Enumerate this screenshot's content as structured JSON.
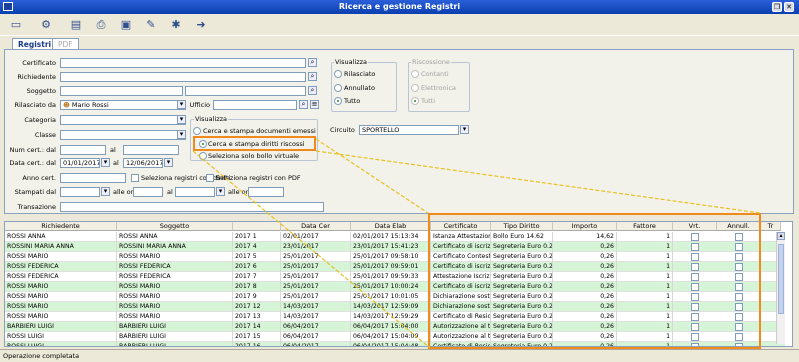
{
  "window": {
    "title": "Ricerca e gestione Registri"
  },
  "toolbar": {
    "icons": [
      "new-icon",
      "tools-icon",
      "document-icon",
      "print-icon",
      "save-icon",
      "edit-icon",
      "settings-icon",
      "exit-icon"
    ]
  },
  "tabs": [
    {
      "label": "Registri"
    },
    {
      "label": "PDF"
    }
  ],
  "form": {
    "certificato_label": "Certificato",
    "richiedente_label": "Richiedente",
    "soggetto_label": "Soggetto",
    "rilasciato_label": "Rilasciato da",
    "rilasciato_value": "Mario Rossi",
    "ufficio_label": "Ufficio",
    "categoria_label": "Categoria",
    "classe_label": "Classe",
    "numcert_label": "Num cert.: dal",
    "al_label": "al",
    "datacert_label": "Data cert.: dal",
    "data_dal": "01/01/2017",
    "data_al": "12/06/2017",
    "anno_label": "Anno cert.",
    "chk_diritti": "Seleziona registri con diritti",
    "chk_pdf": "Seleziona registri con PDF",
    "stampati_label": "Stampati dal",
    "alle_ore": "alle ore",
    "al2": "al",
    "alle_ore2": "alle ore",
    "transazione_label": "Transazione",
    "circuito_label": "Circuito",
    "circuito_value": "SPORTELLO"
  },
  "visualizza1": {
    "title": "Visualizza",
    "options": [
      "Cerca e stampa documenti emessi",
      "Cerca e stampa diritti riscossi",
      "Seleziona solo bollo virtuale"
    ],
    "selected": 1
  },
  "visualizza2": {
    "title": "Visualizza",
    "options": [
      "Rilasciato",
      "Annullato",
      "Tutto"
    ],
    "selected": 2
  },
  "riscossione": {
    "title": "Riscossione",
    "options": [
      "Contanti",
      "Elettronica",
      "Tutti"
    ],
    "selected": 2
  },
  "grid_left": {
    "headers": [
      "Richiedente",
      "Soggetto",
      "",
      "Data Cer",
      "Data Elab"
    ],
    "rows": [
      [
        "ROSSI ANNA",
        "ROSSI ANNA",
        "2017 1",
        "02/01/2017",
        "02/01/2017 15:13:34"
      ],
      [
        "ROSSINI MARIA ANNA",
        "ROSSINI MARIA ANNA",
        "2017 4",
        "23/01/2017",
        "23/01/2017 15:41:23"
      ],
      [
        "ROSSI MARIO",
        "ROSSI MARIO",
        "2017 5",
        "25/01/2017",
        "25/01/2017 09:58:10"
      ],
      [
        "ROSSI FEDERICA",
        "ROSSI FEDERICA",
        "2017 6",
        "25/01/2017",
        "25/01/2017 09:59:01"
      ],
      [
        "ROSSI FEDERICA",
        "ROSSI FEDERICA",
        "2017 7",
        "25/01/2017",
        "25/01/2017 09:59:33"
      ],
      [
        "ROSSI MARIO",
        "ROSSI MARIO",
        "2017 8",
        "25/01/2017",
        "25/01/2017 10:00:24"
      ],
      [
        "ROSSI MARIO",
        "ROSSI MARIO",
        "2017 9",
        "25/01/2017",
        "25/01/2017 10:01:05"
      ],
      [
        "ROSSI MARIO",
        "ROSSI MARIO",
        "2017 12",
        "14/03/2017",
        "14/03/2017 12:59:09"
      ],
      [
        "ROSSI MARIO",
        "ROSSI MARIO",
        "2017 13",
        "14/03/2017",
        "14/03/2017 12:59:29"
      ],
      [
        "BARBIERI LUIGI",
        "BARBIERI LUIGI",
        "2017 14",
        "06/04/2017",
        "06/04/2017 15:04:00"
      ],
      [
        "ROSSI LUIGI",
        "BARBIERI LUIGI",
        "2017 15",
        "06/04/2017",
        "06/04/2017 15:04:09"
      ],
      [
        "ROSSI LUIGI",
        "BARBIERI LUIGI",
        "2017 16",
        "06/04/2017",
        "06/04/2017 15:04:48"
      ]
    ]
  },
  "grid_right": {
    "headers": [
      "Certificato",
      "Tipo Diritto",
      "Importo",
      "Fattore",
      "Vrt.",
      "Annull.",
      "Tr"
    ],
    "rows": [
      [
        "Istanza Attestazione",
        "Bollo Euro 14.62",
        "14,62",
        "1"
      ],
      [
        "Certificato di iscrizio",
        "Segreteria Euro 0.26",
        "0,26",
        "1"
      ],
      [
        "Certificato Contesto",
        "Segreteria Euro 0.26",
        "0,26",
        "1"
      ],
      [
        "Certificato di iscrizio",
        "Segreteria Euro 0.26",
        "0,26",
        "1"
      ],
      [
        "Attestazione Iscrizion",
        "Segreteria Euro 0.26",
        "0,26",
        "1"
      ],
      [
        "Certificato di iscrizio",
        "Segreteria Euro 0.26",
        "0,26",
        "1"
      ],
      [
        "Dichiarazione sostit",
        "Segreteria Euro 0.26",
        "0,26",
        "1"
      ],
      [
        "Dichiarazione sostit",
        "Segreteria Euro 0.26",
        "0,26",
        "1"
      ],
      [
        "Certificato di Reside",
        "Segreteria Euro 0.26",
        "0,26",
        "1"
      ],
      [
        "Autorizzazione al tra",
        "Segreteria Euro 0.26",
        "0,26",
        "1"
      ],
      [
        "Autorizzazione al tra",
        "Segreteria Euro 0.26",
        "0,26",
        "1"
      ],
      [
        "Certificato di Reside",
        "Segreteria Euro 0.26",
        "0,26",
        "1"
      ]
    ]
  },
  "status": {
    "text": "Operazione completata"
  },
  "colors": {
    "highlight": "#f08a1c",
    "row_alt": "#d6f5d6",
    "title": "#0a3fb0"
  }
}
